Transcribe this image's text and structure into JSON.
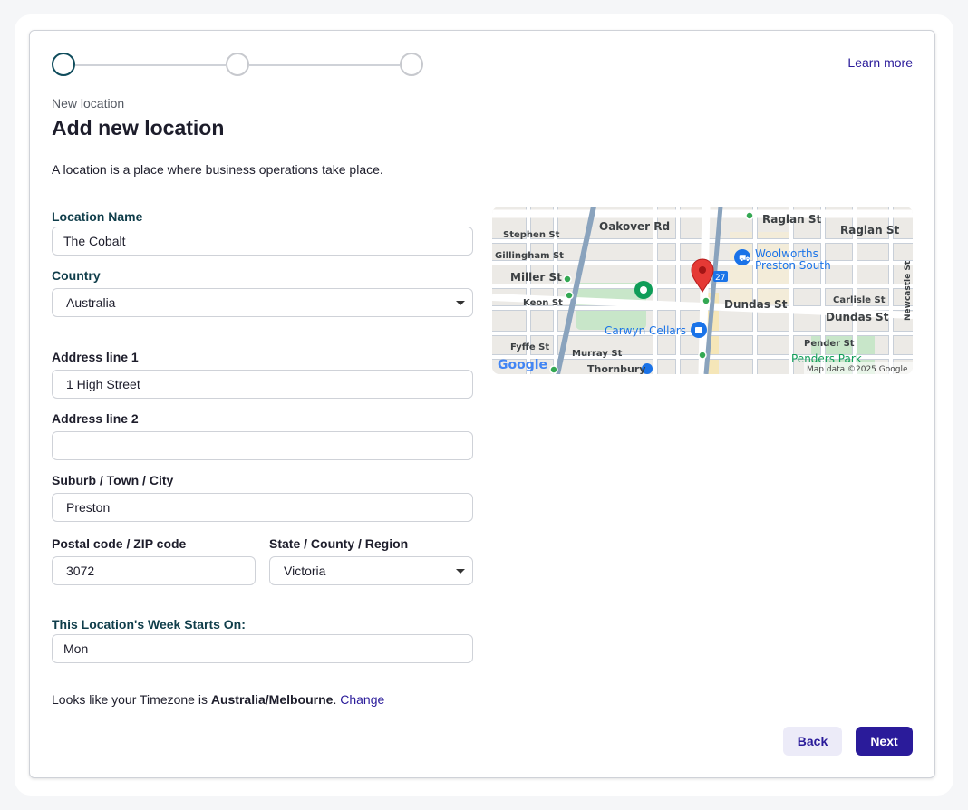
{
  "stepper": {
    "steps": [
      "step-1",
      "step-2",
      "step-3"
    ],
    "active_index": 0
  },
  "header": {
    "learn_more": "Learn more",
    "eyebrow": "New location",
    "title": "Add new location",
    "description": "A location is a place where business operations take place."
  },
  "form": {
    "location_name": {
      "label": "Location Name",
      "value": "The Cobalt"
    },
    "country": {
      "label": "Country",
      "value": "Australia"
    },
    "address1": {
      "label": "Address line 1",
      "value": "1 High Street"
    },
    "address2": {
      "label": "Address line 2",
      "value": ""
    },
    "city": {
      "label": "Suburb / Town / City",
      "value": "Preston"
    },
    "postal": {
      "label": "Postal code / ZIP code",
      "value": "3072"
    },
    "state": {
      "label": "State / County / Region",
      "value": "Victoria"
    },
    "week_start": {
      "label": "This Location's Week Starts On:",
      "value": "Mon"
    }
  },
  "timezone": {
    "prefix": "Looks like your Timezone is ",
    "zone": "Australia/Melbourne",
    "suffix": ". ",
    "change": "Change"
  },
  "buttons": {
    "back": "Back",
    "next": "Next"
  },
  "map": {
    "labels": {
      "oakover": "Oakover Rd",
      "raglan1": "Raglan St",
      "raglan2": "Raglan St",
      "stephen": "Stephen St",
      "gillingham": "Gillingham St",
      "miller": "Miller St",
      "keon": "Keon St",
      "woolworths1": "Woolworths",
      "woolworths2": "Preston South",
      "dundas1": "Dundas St",
      "dundas2": "Dundas St",
      "carlisle": "Carlisle St",
      "newcastle": "Newcastle St",
      "carwyn": "Carwyn Cellars",
      "fyffe": "Fyffe St",
      "murray": "Murray St",
      "thornbury": "Thornbury",
      "pender": "Pender St",
      "penders_park": "Penders Park",
      "google": "Google",
      "copyright": "Map data ©2025 Google",
      "route": "27"
    },
    "colors": {
      "land": "#eceae6",
      "road": "#ffffff",
      "street_outline": "#c8cfd8",
      "rail": "#8aa3bd",
      "park": "#c8e6c9",
      "pin": "#e53935",
      "poi_blue": "#1a73e8",
      "poi_green": "#0f9d58",
      "label_text": "#3c4043",
      "poi_text": "#1a73e8",
      "park_text": "#0f9d58"
    }
  }
}
